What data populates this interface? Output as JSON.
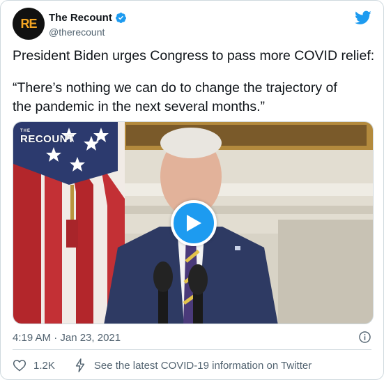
{
  "account": {
    "avatar_text": "RE",
    "display_name": "The Recount",
    "handle": "@therecount"
  },
  "tweet": {
    "line1": "President Biden urges Congress to pass more COVID relief:",
    "line2": "“There’s nothing we can do to change the trajectory of",
    "line3": "the pandemic in the next several months.”"
  },
  "media": {
    "watermark_small": "THE",
    "watermark": "RECOUNT"
  },
  "meta": {
    "timestamp": "4:19 AM · Jan 23, 2021"
  },
  "actions": {
    "like_count": "1.2K",
    "covid_link": "See the latest COVID-19 information on Twitter"
  },
  "colors": {
    "twitter_blue": "#1d9bf0",
    "text_secondary": "#536471",
    "border": "#cfd9de"
  }
}
